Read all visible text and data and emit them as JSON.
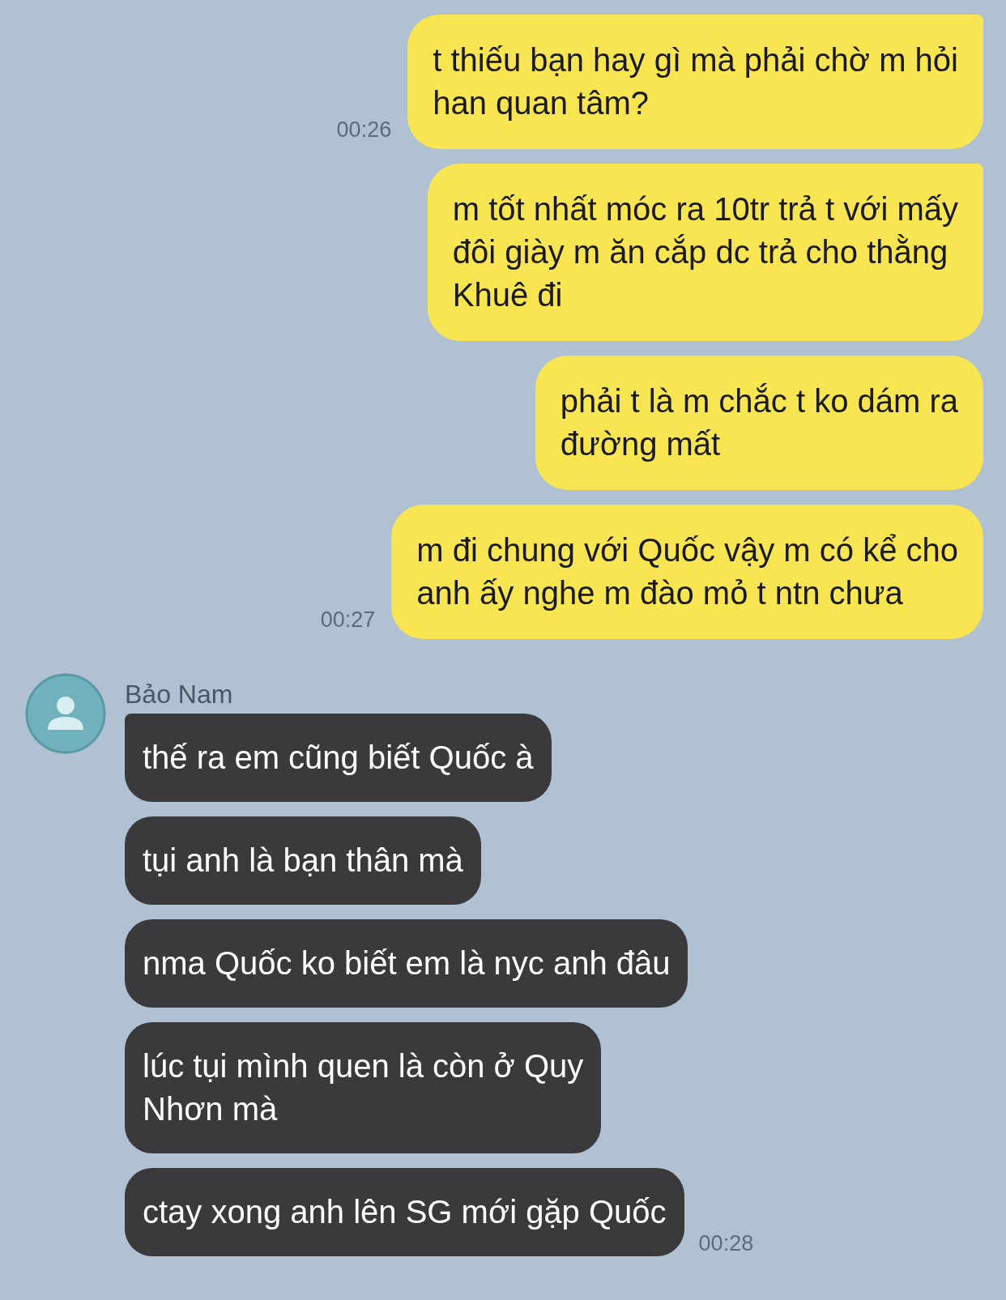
{
  "messages": [
    {
      "kind": "outgoing",
      "lines": [
        "t thiếu bạn hay gì mà phải chờ m hỏi",
        "han quan tâm?"
      ],
      "time": "00:26",
      "tail": true
    },
    {
      "kind": "outgoing",
      "lines": [
        "m tốt nhất móc ra 10tr trả t với mấy",
        "đôi giày m ăn cắp dc trả cho thằng",
        "Khuê đi"
      ],
      "tail": true
    },
    {
      "kind": "outgoing",
      "lines": [
        "phải t là m chắc t ko dám ra",
        "đường mất"
      ],
      "tail": false
    },
    {
      "kind": "outgoing",
      "lines": [
        "m đi chung với Quốc vậy m có kể cho",
        "anh ấy nghe m đào mỏ t ntn chưa"
      ],
      "time": "00:27",
      "tail": false
    },
    {
      "kind": "sender",
      "name": "Bảo Nam"
    },
    {
      "kind": "incoming",
      "lines": [
        "thế ra em cũng biết Quốc à"
      ],
      "tail": true
    },
    {
      "kind": "incoming",
      "lines": [
        "tụi anh là bạn thân mà"
      ],
      "tail": false
    },
    {
      "kind": "incoming",
      "lines": [
        "nma Quốc ko biết em là nyc anh đâu"
      ],
      "tail": false
    },
    {
      "kind": "incoming",
      "lines": [
        "lúc tụi mình quen là còn ở Quy",
        "Nhơn mà"
      ],
      "tail": false
    },
    {
      "kind": "incoming",
      "lines": [
        "ctay xong anh lên SG mới gặp Quốc"
      ],
      "time": "00:28",
      "tail": false
    }
  ]
}
